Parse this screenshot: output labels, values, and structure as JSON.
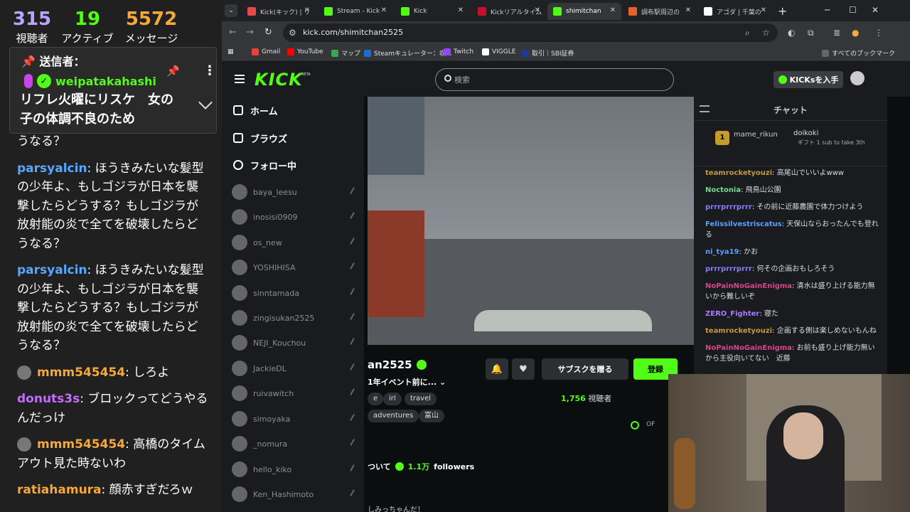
{
  "overlay": {
    "stats": [
      {
        "value": "315",
        "label": "視聴者",
        "color": "#b9a4ff"
      },
      {
        "value": "19",
        "label": "アクティブ",
        "color": "#53fc18"
      },
      {
        "value": "5572",
        "label": "メッセージ",
        "color": "#f6a93b"
      }
    ],
    "pinned": {
      "header": "送信者：",
      "user": "weipatakahashi",
      "text": "リフレ火曜にリスケ　女の子の体調不良のため"
    },
    "messages": [
      {
        "user": "",
        "text": "うなる？",
        "color": "#fff",
        "avatar": false
      },
      {
        "user": "parsyalcin",
        "text": ": ほうきみたいな髪型の少年よ、もしゴジラが日本を襲撃したらどうする？もしゴジラが放射能の炎で全てを破壊したらどうなる？",
        "color": "#59a7ff",
        "avatar": false
      },
      {
        "user": "parsyalcin",
        "text": ": ほうきみたいな髪型の少年よ、もしゴジラが日本を襲撃したらどうする？もしゴジラが放射能の炎で全てを破壊したらどうなる？",
        "color": "#59a7ff",
        "avatar": false
      },
      {
        "user": "mmm545454",
        "text": ": しろよ",
        "color": "#f6a93b",
        "avatar": true
      },
      {
        "user": "donuts3s",
        "text": ": ブロックってどうやるんだっけ",
        "color": "#c46cff",
        "avatar": false
      },
      {
        "user": "mmm545454",
        "text": ": 高橋のタイムアウト見た時ないわ",
        "color": "#f6a93b",
        "avatar": true
      },
      {
        "user": "ratiahamura",
        "text": ": 顔赤すぎだろｗ",
        "color": "#f6a93b",
        "avatar": false
      }
    ]
  },
  "browser": {
    "tabs": [
      {
        "title": "Kick(キック) | リ",
        "color": "#e34a4a",
        "active": false
      },
      {
        "title": "Stream - Kick",
        "color": "#53fc18",
        "active": false
      },
      {
        "title": "Kick",
        "color": "#53fc18",
        "active": false
      },
      {
        "title": "Kickリアルタイム",
        "color": "#c8102e",
        "active": false
      },
      {
        "title": "shimitchan",
        "color": "#53fc18",
        "active": true
      },
      {
        "title": "調布駅周辺の",
        "color": "#e8612c",
        "active": false
      },
      {
        "title": "アゴダ | 千葉の",
        "color": "#ffffff",
        "active": false
      }
    ],
    "url": "kick.com/shimitchan2525",
    "bookmarks": [
      {
        "label": "Gmail",
        "color": "#ea4335"
      },
      {
        "label": "YouTube",
        "color": "#ff0000"
      },
      {
        "label": "マップ",
        "color": "#34a853"
      },
      {
        "label": "Steamキュレーター：収...",
        "color": "#1b6ed1"
      },
      {
        "label": "Twitch",
        "color": "#9146ff"
      },
      {
        "label": "VIGGLE",
        "color": "#ffffff"
      },
      {
        "label": "取引｜SBI証券",
        "color": "#1d3c8f"
      }
    ],
    "all_bookmarks": "すべてのブックマーク"
  },
  "kick": {
    "logo": "KICK",
    "beta": "BETA",
    "search_placeholder": "検索",
    "kicks_button": "KICKsを入手",
    "nav": [
      {
        "label": "ホーム"
      },
      {
        "label": "ブラウズ"
      },
      {
        "label": "フォロー中"
      }
    ],
    "following": [
      "baya_leesu",
      "inosisi0909",
      "os_new",
      "YOSHIHISA",
      "sinntamada",
      "zingisukan2525",
      "NEJI_Kouchou",
      "JackieDL",
      "ruivawitch",
      "simoyaka",
      "_nomura",
      "hello_kiko",
      "Ken_Hashimoto"
    ],
    "channel_name": "an2525",
    "stream_title": "1年イベント前に...",
    "tags": [
      "e",
      "irl",
      "travel",
      "adventures",
      "富山"
    ],
    "subscribe_gift": "サブスクを贈る",
    "register": "登録",
    "viewers_count": "1,756",
    "viewers_label": "視聴者",
    "off_label": "OF",
    "about_prefix": "ついて",
    "followers_count": "1.1万",
    "followers_label": "followers",
    "description": "しみっちゃんだ！",
    "chat": {
      "title": "チャット",
      "leader1": "mame_rikun",
      "leader1_badge": "1",
      "leader2": "doikoki",
      "gift_note": "ギフト 1 sub to take 3th",
      "messages": [
        {
          "user": "teamrocketyouzi",
          "text": ": 高尾山でいいよwww",
          "color": "#c49a3a"
        },
        {
          "user": "Noctonia",
          "text": ": 飛鳥山公園",
          "color": "#7bd88f"
        },
        {
          "user": "prrrprrrprrr",
          "text": ": その前に近藤農園で体力つけよう",
          "color": "#8a7cff"
        },
        {
          "user": "Felissilvestriscatus",
          "text": ": 天保山ならおったんでも登れる",
          "color": "#5aa0ff"
        },
        {
          "user": "ni_tya19",
          "text": ": かお",
          "color": "#5aa0ff"
        },
        {
          "user": "prrrprrrprrr",
          "text": ": 何その企画おもしろそう",
          "color": "#8a7cff"
        },
        {
          "user": "NoPainNoGainEnigma",
          "text": ": 清水は盛り上げる能力無いから難しいぞ",
          "color": "#d6478a"
        },
        {
          "user": "ZERO_Fighter",
          "text": ": 寝た",
          "color": "#a77cff"
        },
        {
          "user": "teamrocketyouzi",
          "text": ": 企画する側は楽しめないもんね",
          "color": "#c49a3a"
        },
        {
          "user": "NoPainNoGainEnigma",
          "text": ": お前も盛り上げ能力無いから主役向いてない　近藤",
          "color": "#d6478a"
        }
      ]
    }
  }
}
